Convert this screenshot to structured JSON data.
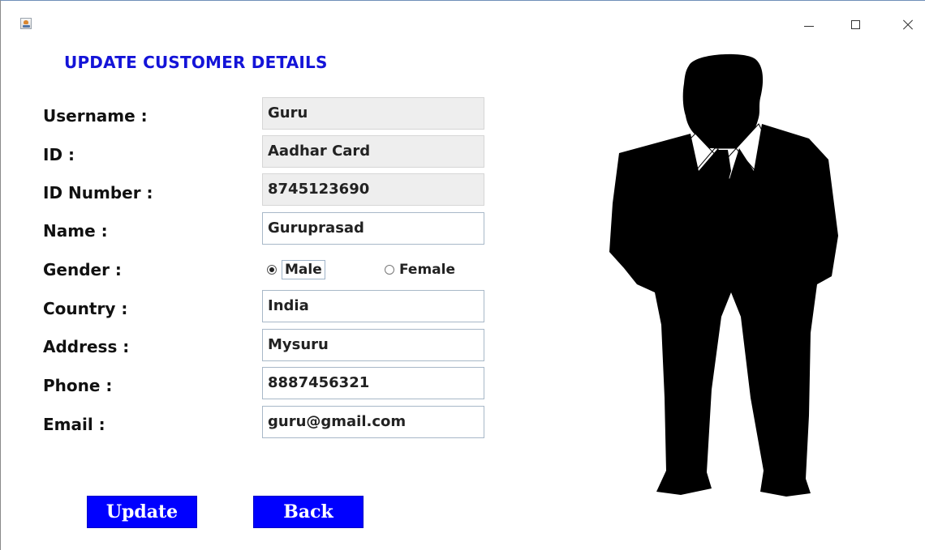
{
  "window": {
    "title": "",
    "icon": "java-cup-icon",
    "controls": {
      "minimize": "minimize-icon",
      "maximize": "maximize-icon",
      "close": "close-icon"
    }
  },
  "form": {
    "title": "UPDATE CUSTOMER DETAILS",
    "title_color": "#1414d8",
    "fields": {
      "username": {
        "label": "Username :",
        "value": "Guru",
        "editable": false
      },
      "id": {
        "label": "ID :",
        "value": "Aadhar Card",
        "editable": false
      },
      "id_number": {
        "label": "ID Number :",
        "value": "8745123690",
        "editable": false
      },
      "name": {
        "label": "Name :",
        "value": "Guruprasad",
        "editable": true
      },
      "gender": {
        "label": "Gender :",
        "options": [
          {
            "label": "Male",
            "selected": true
          },
          {
            "label": "Female",
            "selected": false
          }
        ]
      },
      "country": {
        "label": "Country :",
        "value": "India",
        "editable": true
      },
      "address": {
        "label": "Address :",
        "value": "Mysuru",
        "editable": true
      },
      "phone": {
        "label": "Phone :",
        "value": "8887456321",
        "editable": true
      },
      "email": {
        "label": "Email :",
        "value": "guru@gmail.com",
        "editable": true
      }
    }
  },
  "buttons": {
    "update": "Update",
    "back": "Back",
    "color": "#0000ff",
    "text_color": "#ffffff"
  },
  "image": {
    "subject": "businessman-silhouette"
  }
}
